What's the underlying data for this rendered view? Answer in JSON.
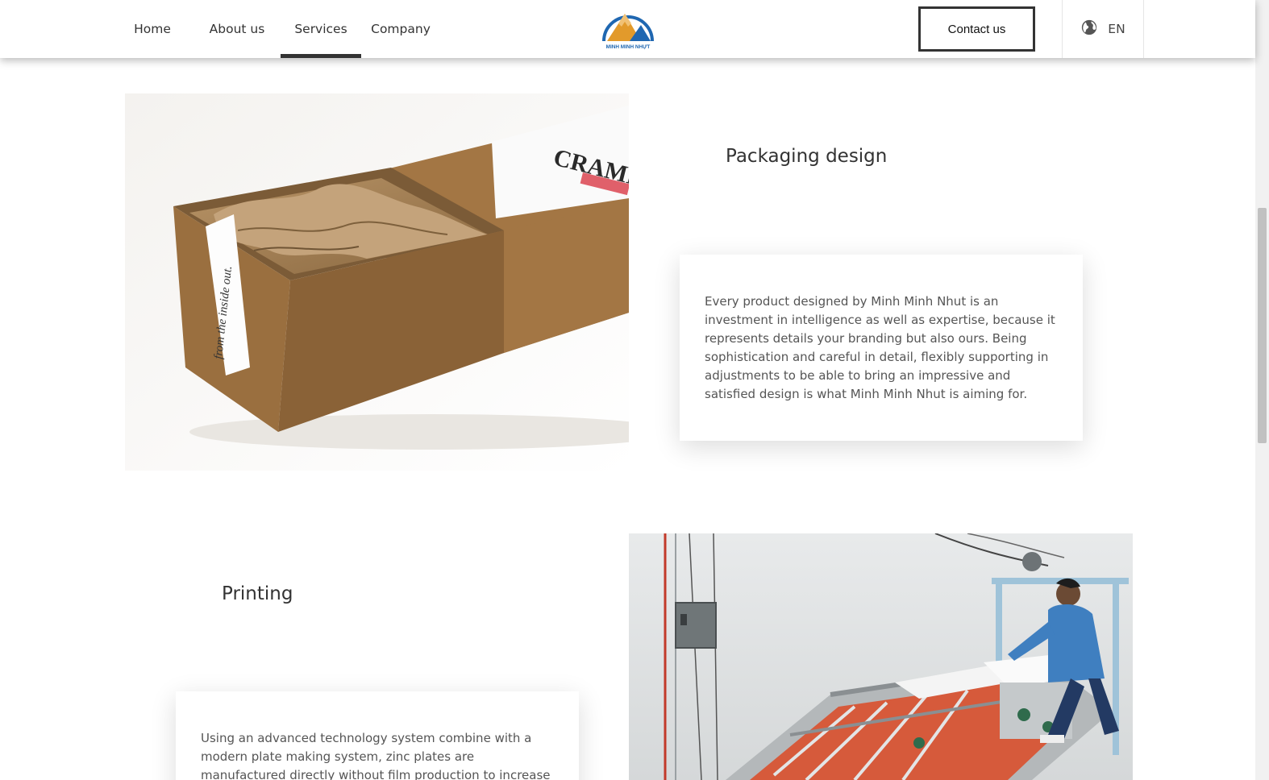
{
  "header": {
    "nav": [
      {
        "label": "Home"
      },
      {
        "label": "About us"
      },
      {
        "label": "Services"
      },
      {
        "label": "Company"
      }
    ],
    "active_nav": "Services",
    "logo_text": "MINH MINH NHỰT",
    "contact_label": "Contact us",
    "language": "EN",
    "icons": {
      "language": "globe-icon"
    }
  },
  "sections": {
    "packaging": {
      "title": "Packaging design",
      "description": "Every product designed by Minh Minh Nhut is an investment in intelligence as well as expertise, because it represents details your branding but also ours. Being sophistication and careful in detail, flexibly supporting in adjustments to be able to bring an impressive and satisfied design is what Minh Minh Nhut is aiming for.",
      "image_text": {
        "brand": "CRAMP",
        "tape": "from the inside out."
      }
    },
    "printing": {
      "title": "Printing",
      "description": "Using an advanced technology system combine with a modern plate making system, zinc plates are manufactured directly without film production to increase the quality of"
    }
  },
  "colors": {
    "logo_orange": "#e29a2b",
    "logo_blue": "#1f67b1",
    "text": "#333333",
    "kraft": "#b98a55"
  }
}
